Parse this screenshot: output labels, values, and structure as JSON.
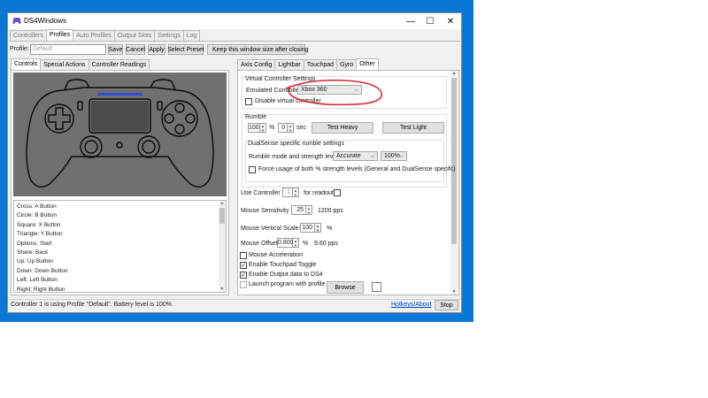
{
  "window": {
    "title": "DS4Windows",
    "minimize": "—",
    "maximize": "☐",
    "close": "✕"
  },
  "main_tabs": [
    "Controllers",
    "Profiles",
    "Auto Profiles",
    "Output Slots",
    "Settings",
    "Log"
  ],
  "profile_bar": {
    "label": "Profile:",
    "placeholder": "Default",
    "save": "Save",
    "cancel": "Cancel",
    "apply": "Apply",
    "select_preset": "Select Preset",
    "keep_size": "Keep this window size after closing"
  },
  "left_tabs": [
    "Controls",
    "Special Actions",
    "Controller Readings"
  ],
  "mappings": [
    "Cross: A Button",
    "Circle: B Button",
    "Square: X Button",
    "Triangle: Y Button",
    "Options: Start",
    "Share: Back",
    "Up: Up Button",
    "Down: Down Button",
    "Left: Left Button",
    "Right: Right Button"
  ],
  "right_tabs": [
    "Axis Config",
    "Lightbar",
    "Touchpad",
    "Gyro",
    "Other"
  ],
  "virtual": {
    "header": "Virtual Controller Settings",
    "emulated_label": "Emulated Controller",
    "emulated_value": "Xbox 360",
    "disable_label": "Disable virtual controller"
  },
  "rumble": {
    "header": "Rumble",
    "percent": "100",
    "percent_unit": "%",
    "sec": "0",
    "sec_unit": "sec",
    "test_heavy": "Test Heavy",
    "test_light": "Test Light",
    "dualsense_header": "DualSense specific rumble settings",
    "mode_label": "Rumble mode and strength level:",
    "mode_value": "Accurate",
    "strength_value": "100%",
    "force_label": "Force usage of both % strength levels (General and DualSense specifc)"
  },
  "other": {
    "use_controller_label": "Use Controller",
    "use_controller_value": "1",
    "for_readout": "for readout",
    "mouse_sens_label": "Mouse Sensitivity",
    "mouse_sens_value": "25",
    "mouse_sens_unit": "1200 pps",
    "mouse_vscale_label": "Mouse Vertical Scale:",
    "mouse_vscale_value": "100",
    "mouse_vscale_unit": "%",
    "mouse_offset_label": "Mouse Offset",
    "mouse_offset_value": "0.800",
    "mouse_offset_unit": "%",
    "mouse_offset_pps": "9.60 pps",
    "mouse_accel": "Mouse Acceleration",
    "touchpad_toggle": "Enable Touchpad Toggle",
    "output_ds4": "Enable Output data to DS4",
    "launch_program": "Launch program with profile",
    "browse": "Browse"
  },
  "checks": {
    "checked": "✓"
  },
  "status": {
    "text": "Controller 1 is using Profile \"Default\". Battery level is 100%",
    "hotkeys": "Hotkeys/About",
    "stop": "Stop"
  },
  "colors": {
    "desktop": "#0a78d7",
    "annotation": "#d3262b",
    "gamepad_bg": "#707070",
    "lightbar": "#3050d8"
  }
}
